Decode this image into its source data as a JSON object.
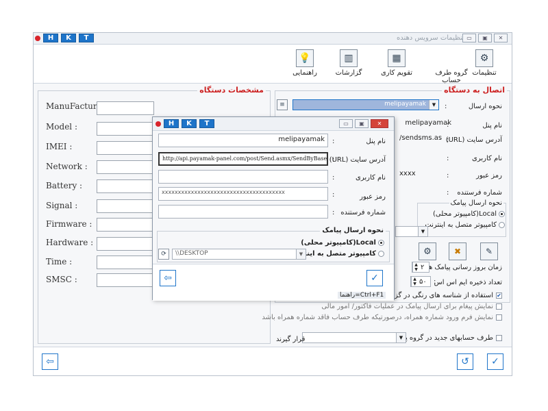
{
  "colors": {
    "accent": "#1e74c9",
    "section_title": "#cc1f1f",
    "close": "#d4443a"
  },
  "hkt_keys": [
    "H",
    "K",
    "T"
  ],
  "main": {
    "title": "تنظیمات سرویس دهنده",
    "ribbon": [
      {
        "label": "تنظیمات",
        "icon": "gear-icon"
      },
      {
        "label": "گروه طرف حساب",
        "icon": ""
      },
      {
        "label": "تقویم کاری",
        "icon": "calendar-icon"
      },
      {
        "label": "گزارشات",
        "icon": "chart-icon"
      },
      {
        "label": "راهنمایی",
        "icon": "lightbulb-icon"
      }
    ],
    "device_specs": {
      "title": "مشخصات دستگاه",
      "fields": [
        "ManuFacture :",
        "Model :",
        "IMEI :",
        "Network :",
        "Battery :",
        "Signal :",
        "Firmware :",
        "Hardware :",
        "Time :",
        "SMSC :"
      ]
    },
    "connection": {
      "title": "اتصال به دستگاه",
      "send_method_label": "نحوه ارسال",
      "send_method_value": "melipayamak",
      "panel_name_label": "نام پنل",
      "panel_name_value": "melipayamak",
      "url_label": "آدرس سایت (URL)",
      "url_value": "/sendsms.ashx?",
      "username_label": "نام کاربری",
      "password_label": "رمز عبور",
      "password_value": "xxxx",
      "sender_label": "شماره فرستنده",
      "send_type_title": "نحوه ارسال پیامک",
      "local_label": "Local(کامپیوتر محلی)",
      "internet_label": "کامپیوتر متصل به اینترنت",
      "refresh_label": "زمان بروز رسانی پیامک ها هر",
      "refresh_value": "۲",
      "history_label": "تعداد ذخیره ایم اس اس",
      "history_value": "۵۰",
      "chk_colors": "استفاده از شناسه های رنگی در گزارشات",
      "chk_notify": "نمایش پیغام برای ارسال پیامک در عملیات فاکتور/ امور مالی",
      "chk_mobile_form": "نمایش فرم ورود شماره همراه، درصورتیکه طرف حساب فاقد شماره همراه باشد",
      "chk_new_accounts": "طرف حسابهای جدید در گروه پیامک",
      "placed_label": "قرار گیرند"
    }
  },
  "dialog": {
    "panel_name_label": "نام پنل",
    "panel_name_value": "melipayamak",
    "url_label": "آدرس سایت (URL)",
    "url_value": "http://api.payamak-panel.com/post/Send.asmx/SendByBaseNumber3?",
    "username_label": "نام کاربری",
    "password_label": "رمز عبور",
    "password_value": "xxxxxxxxxxxxxxxxxxxxxxxxxxxxxxxxxxxxxx",
    "sender_label": "شماره فرستنده",
    "send_type_title": "نحوه ارسال پیامک",
    "local_label": "Local(کامپیوتر محلی)",
    "internet_label": "کامپیوتر متصل به اینترنت",
    "computer_value": "\\\\DESKTOP",
    "help_text": "راهنما=Ctrl+F1"
  }
}
